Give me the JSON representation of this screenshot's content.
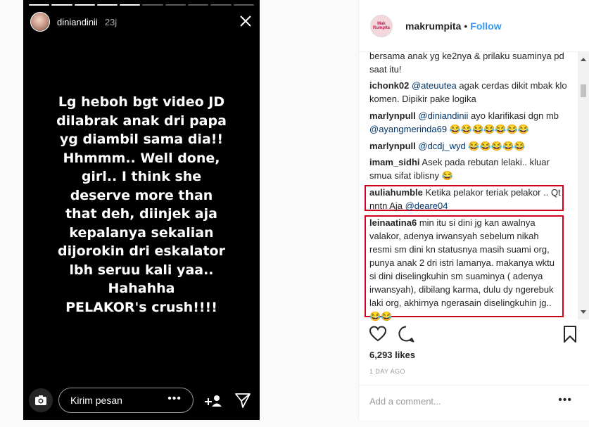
{
  "story": {
    "username": "diniandinii",
    "time": "23j",
    "text": "Lg heboh bgt video JD\ndilabrak anak dri papa\nyg diambil sama dia!!\nHhmmm.. Well done,\ngirl.. I think she\ndeserve more than\nthat deh, diinjek aja\nkepalanya sekalian\ndijorokin dri eskalator\nlbh seruu kali yaa..\nHahahha\nPELAKOR's crush!!!!",
    "message_placeholder": "Kirim pesan",
    "more": "•••",
    "progress_segments": [
      1,
      1,
      1,
      1,
      1,
      0,
      0,
      0,
      0,
      0
    ]
  },
  "post": {
    "avatar_text": "Mak Rumpita",
    "username": "makrumpita",
    "separator": "•",
    "follow_label": "Follow",
    "comments": [
      {
        "user": "",
        "text": "bersama anak yg ke2nya & prilaku suaminya pd saat itu!"
      },
      {
        "user": "ichonk02",
        "mention": "@ateuutea",
        "text": " agak cerdas dikit mbak klo komen. Dipikir pake logika"
      },
      {
        "user": "marlynpull",
        "mention": "@diniandinii",
        "text": " ayo klarifikasi dgn mb ",
        "mention2": "@ayangmerinda69",
        "text2": " 😂😂😂😂😂😂😂"
      },
      {
        "user": "marlynpull",
        "mention": "@dcdj_wyd",
        "text": " 😂😂😂😂😂"
      },
      {
        "user": "imam_sidhi",
        "text": " Asek pada rebutan lelaki.. kluar smua sifat iblisny 😂"
      },
      {
        "user": "auliahumble",
        "text": " Ketika pelakor teriak pelakor .. Qt nntn Aja ",
        "mention": "@deare04"
      },
      {
        "user": "leinaatina6",
        "text": " min itu si dini jg kan awalnya valakor, adenya irwansyah sebelum nikah resmi sm dini kn statusnya masih suami org, punya anak 2 dri istri lamanya. makanya wktu si dini diselingkuhin sm suaminya ( adenya irwansyah), dibilang karma, dulu dy ngerebuk laki org, akhirnya ngerasain diselingkuhin jg.. 😂😂"
      }
    ],
    "likes": "6,293 likes",
    "time_ago": "1 DAY AGO",
    "add_comment_placeholder": "Add a comment...",
    "more": "•••"
  }
}
